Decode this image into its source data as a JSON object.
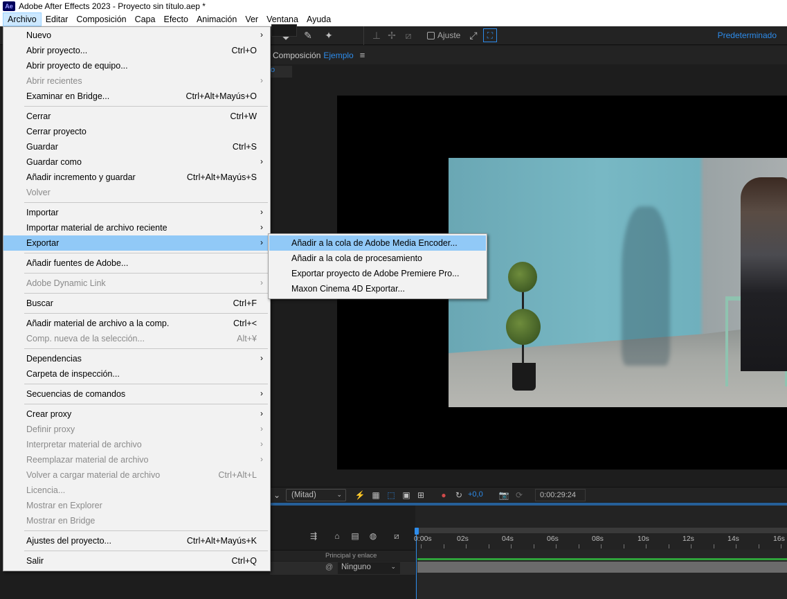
{
  "window": {
    "title": "Adobe After Effects 2023 - Proyecto sin título.aep *",
    "app_icon": "Ae"
  },
  "menubar": [
    "Archivo",
    "Editar",
    "Composición",
    "Capa",
    "Efecto",
    "Animación",
    "Ver",
    "Ventana",
    "Ayuda"
  ],
  "toolbar": {
    "snap_label": "Ajuste",
    "workspace": "Predeterminado"
  },
  "composition": {
    "label": "Composición",
    "name": "Ejemplo",
    "tab_fragment": "o"
  },
  "viewer_controls": {
    "resolution": "(Mitad)",
    "exposure": "+0,0",
    "timecode": "0:00:29:24"
  },
  "timeline": {
    "ticks": [
      "0:00s",
      "02s",
      "04s",
      "06s",
      "08s",
      "10s",
      "12s",
      "14s",
      "16s"
    ],
    "parent_header": "Principal y enlace",
    "parent_value": "Ninguno"
  },
  "file_menu": [
    {
      "label": "Nuevo",
      "submenu": true
    },
    {
      "label": "Abrir proyecto...",
      "shortcut": "Ctrl+O"
    },
    {
      "label": "Abrir proyecto de equipo..."
    },
    {
      "label": "Abrir recientes",
      "submenu": true,
      "disabled": true
    },
    {
      "label": "Examinar en Bridge...",
      "shortcut": "Ctrl+Alt+Mayús+O"
    },
    {
      "separator": true
    },
    {
      "label": "Cerrar",
      "shortcut": "Ctrl+W"
    },
    {
      "label": "Cerrar proyecto"
    },
    {
      "label": "Guardar",
      "shortcut": "Ctrl+S"
    },
    {
      "label": "Guardar como",
      "submenu": true
    },
    {
      "label": "Añadir incremento y guardar",
      "shortcut": "Ctrl+Alt+Mayús+S"
    },
    {
      "label": "Volver",
      "disabled": true
    },
    {
      "separator": true
    },
    {
      "label": "Importar",
      "submenu": true
    },
    {
      "label": "Importar material de archivo reciente",
      "submenu": true
    },
    {
      "label": "Exportar",
      "submenu": true,
      "highlighted": true
    },
    {
      "separator": true
    },
    {
      "label": "Añadir fuentes de Adobe..."
    },
    {
      "separator": true
    },
    {
      "label": "Adobe Dynamic Link",
      "submenu": true,
      "disabled": true
    },
    {
      "separator": true
    },
    {
      "label": "Buscar",
      "shortcut": "Ctrl+F"
    },
    {
      "separator": true
    },
    {
      "label": "Añadir material de archivo a la comp.",
      "shortcut": "Ctrl+<"
    },
    {
      "label": "Comp. nueva de la selección...",
      "shortcut": "Alt+¥",
      "disabled": true
    },
    {
      "separator": true
    },
    {
      "label": "Dependencias",
      "submenu": true
    },
    {
      "label": "Carpeta de inspección..."
    },
    {
      "separator": true
    },
    {
      "label": "Secuencias de comandos",
      "submenu": true
    },
    {
      "separator": true
    },
    {
      "label": "Crear proxy",
      "submenu": true
    },
    {
      "label": "Definir proxy",
      "submenu": true,
      "disabled": true
    },
    {
      "label": "Interpretar material de archivo",
      "submenu": true,
      "disabled": true
    },
    {
      "label": "Reemplazar material de archivo",
      "submenu": true,
      "disabled": true
    },
    {
      "label": "Volver a cargar material de archivo",
      "shortcut": "Ctrl+Alt+L",
      "disabled": true
    },
    {
      "label": "Licencia...",
      "disabled": true
    },
    {
      "label": "Mostrar en Explorer",
      "disabled": true
    },
    {
      "label": "Mostrar en Bridge",
      "disabled": true
    },
    {
      "separator": true
    },
    {
      "label": "Ajustes del proyecto...",
      "shortcut": "Ctrl+Alt+Mayús+K"
    },
    {
      "separator": true
    },
    {
      "label": "Salir",
      "shortcut": "Ctrl+Q"
    }
  ],
  "export_submenu": [
    {
      "label": "Añadir a la cola de Adobe Media Encoder...",
      "highlighted": true
    },
    {
      "label": "Añadir a la cola de procesamiento"
    },
    {
      "label": "Exportar proyecto de Adobe Premiere Pro..."
    },
    {
      "label": "Maxon Cinema 4D Exportar..."
    }
  ],
  "colors": {
    "accent": "#2d8ceb",
    "menu_highlight": "#91c9f7",
    "menu_bg": "#f2f2f2",
    "panel_bg": "#232323"
  }
}
